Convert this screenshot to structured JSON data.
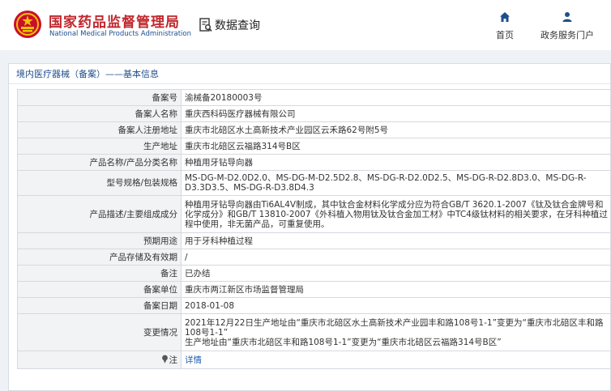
{
  "header": {
    "brand_cn": "国家药品监督管理局",
    "brand_en": "National Medical Products Administration",
    "data_query": "数据查询",
    "nav": [
      {
        "label": "首页",
        "icon": "home-icon"
      },
      {
        "label": "政务服务门户",
        "icon": "user-icon"
      }
    ]
  },
  "breadcrumb": "境内医疗器械（备案）——基本信息",
  "records": [
    {
      "label": "备案号",
      "value": "渝械备20180003号"
    },
    {
      "label": "备案人名称",
      "value": "重庆西科码医疗器械有限公司"
    },
    {
      "label": "备案人注册地址",
      "value": "重庆市北碚区水土高新技术产业园区云禾路62号附5号"
    },
    {
      "label": "生产地址",
      "value": "重庆市北碚区云福路314号B区"
    },
    {
      "label": "产品名称/产品分类名称",
      "value": "种植用牙钻导向器"
    },
    {
      "label": "型号规格/包装规格",
      "value": "MS-DG-M-D2.0D2.0、MS-DG-M-D2.5D2.8、MS-DG-R-D2.0D2.5、MS-DG-R-D2.8D3.0、MS-DG-R-D3.3D3.5、MS-DG-R-D3.8D4.3"
    },
    {
      "label": "产品描述/主要组成成分",
      "value": "种植用牙钻导向器由Ti6AL4V制成，其中钛合金材料化学成分应为符合GB/T 3620.1-2007《钛及钛合金牌号和化学成分》和GB/T 13810-2007《外科植入物用钛及钛合金加工材》中TC4级钛材料的相关要求，在牙科种植过程中使用，非无菌产品，可重复使用。"
    },
    {
      "label": "预期用途",
      "value": "用于牙科种植过程"
    },
    {
      "label": "产品存储及有效期",
      "value": "/"
    },
    {
      "label": "备注",
      "value": "已办结"
    },
    {
      "label": "备案单位",
      "value": "重庆市两江新区市场监督管理局"
    },
    {
      "label": "备案日期",
      "value": "2018-01-08"
    },
    {
      "label": "变更情况",
      "value": "2021年12月22日生产地址由“重庆市北碚区水土高新技术产业园丰和路108号1-1”变更为“重庆市北碚区丰和路108号1-1”\n生产地址由“重庆市北碚区丰和路108号1-1”变更为“重庆市北碚区云福路314号B区”"
    },
    {
      "label": "注",
      "value": "详情",
      "icon": "pin-icon"
    }
  ]
}
